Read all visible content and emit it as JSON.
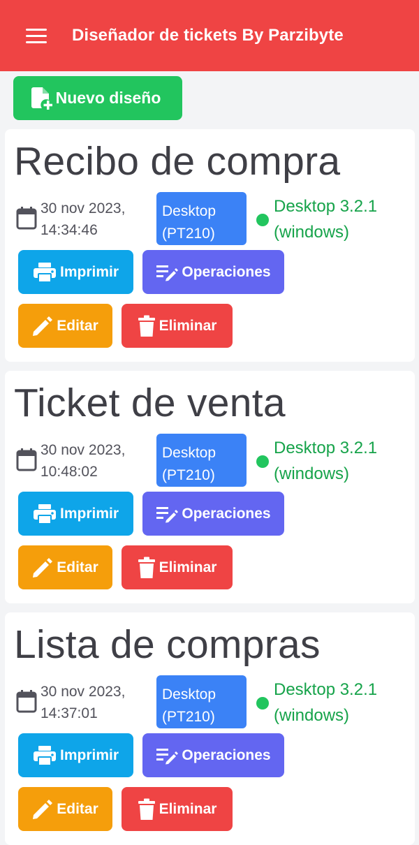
{
  "header": {
    "title": "Diseñador de tickets By Parzibyte",
    "menu_icon": "hamburger-menu-icon"
  },
  "toolbar": {
    "new_label": "Nuevo diseño",
    "new_icon": "file-plus-icon"
  },
  "actions": {
    "print": "Imprimir",
    "operations": "Operaciones",
    "edit": "Editar",
    "delete": "Eliminar"
  },
  "designs": [
    {
      "title": "Recibo de compra",
      "date": "30 nov 2023,",
      "time": "14:34:46",
      "printer_line1": "Desktop",
      "printer_line2": "(PT210)",
      "version_line1": "Desktop 3.2.1",
      "version_line2": "(windows)"
    },
    {
      "title": "Ticket de venta",
      "date": "30 nov 2023,",
      "time": "10:48:02",
      "printer_line1": "Desktop",
      "printer_line2": "(PT210)",
      "version_line1": "Desktop 3.2.1",
      "version_line2": "(windows)"
    },
    {
      "title": "Lista de compras",
      "date": "30 nov 2023,",
      "time": "14:37:01",
      "printer_line1": "Desktop",
      "printer_line2": "(PT210)",
      "version_line1": "Desktop 3.2.1",
      "version_line2": "(windows)"
    }
  ],
  "colors": {
    "topbar": "#ef4444",
    "new_button": "#22c55e",
    "print_button": "#0ea5e9",
    "operations_button": "#6366f1",
    "edit_button": "#f59e0b",
    "delete_button": "#ef4444",
    "printer_badge": "#3b82f6",
    "status_online": "#22c55e"
  }
}
